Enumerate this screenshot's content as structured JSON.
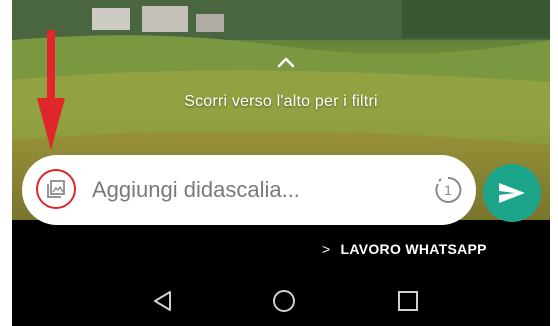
{
  "hint": {
    "text": "Scorri verso l'alto per i filtri"
  },
  "caption": {
    "placeholder": "Aggiungi didascalia..."
  },
  "timer": {
    "label": "1"
  },
  "recipient": {
    "chevron": ">",
    "name": "LAVORO WHATSAPP"
  },
  "colors": {
    "send_button": "#1da58a",
    "highlight": "#e0262a",
    "background": "#000000"
  },
  "icons": {
    "gallery": "gallery-icon",
    "timer": "view-once-icon",
    "send": "send-icon",
    "back": "nav-back-icon",
    "home": "nav-home-icon",
    "recent": "nav-recent-icon"
  }
}
